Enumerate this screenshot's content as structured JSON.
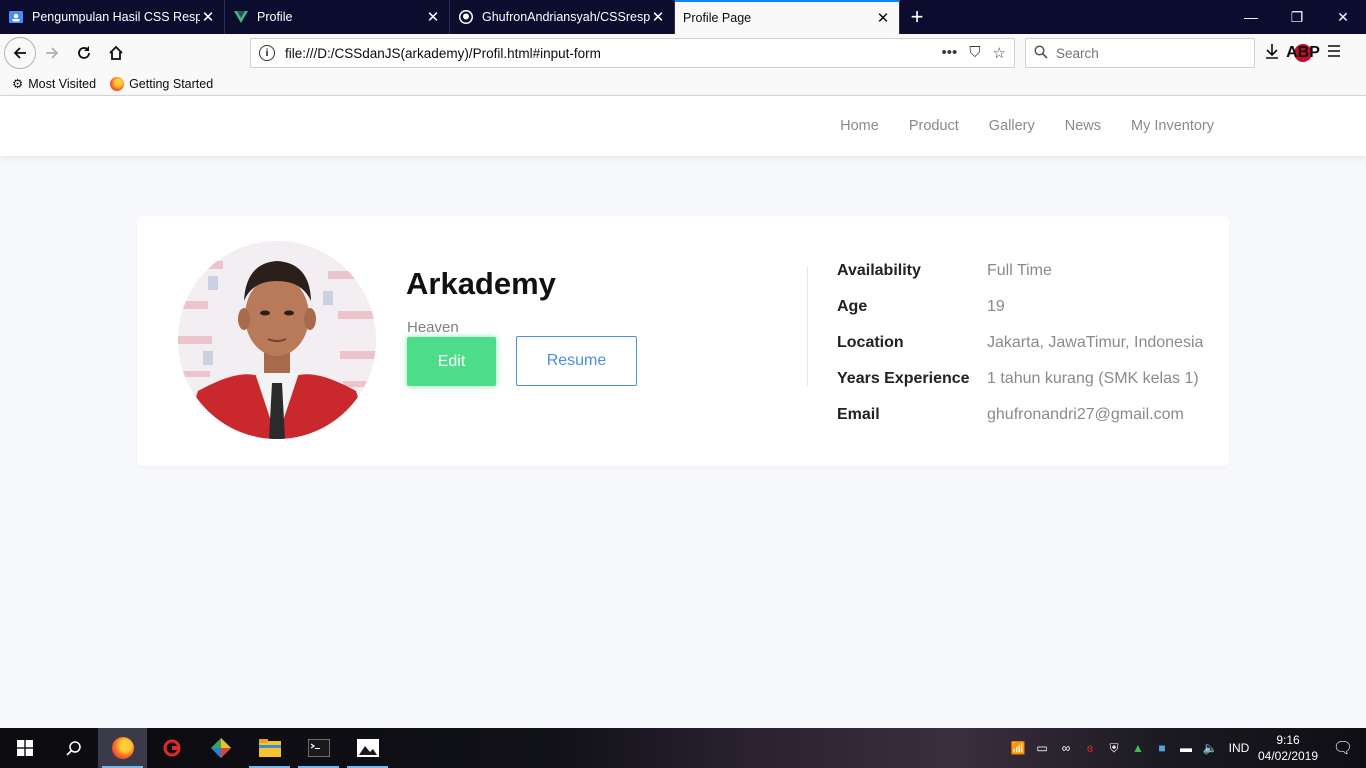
{
  "browser": {
    "tabs": [
      {
        "title": "Pengumpulan Hasil CSS Respo",
        "icon": "classroom-icon",
        "active": false
      },
      {
        "title": "Profile",
        "icon": "vue-icon",
        "active": false
      },
      {
        "title": "GhufronAndriansyah/CSSrespo",
        "icon": "github-icon",
        "active": false
      },
      {
        "title": "Profile Page",
        "icon": "",
        "active": true
      }
    ],
    "new_tab": "+",
    "url": "file:///D:/CSSdanJS(arkademy)/Profil.html#input-form",
    "search_placeholder": "Search",
    "abp_label": "ABP",
    "bookmarks": [
      "Most Visited",
      "Getting Started"
    ]
  },
  "navbar": {
    "links": [
      "Home",
      "Product",
      "Gallery",
      "News",
      "My Inventory"
    ]
  },
  "profile": {
    "name": "Arkademy",
    "role": "Heaven",
    "edit_label": "Edit",
    "resume_label": "Resume",
    "details": [
      {
        "label": "Availability",
        "value": "Full Time"
      },
      {
        "label": "Age",
        "value": "19"
      },
      {
        "label": "Location",
        "value": "Jakarta, JawaTimur, Indonesia"
      },
      {
        "label": "Years Experience",
        "value": "1 tahun kurang (SMK kelas 1)"
      },
      {
        "label": "Email",
        "value": "ghufronandri27@gmail.com"
      }
    ]
  },
  "taskbar": {
    "language": "IND",
    "time": "9:16",
    "date": "04/02/2019"
  },
  "colors": {
    "edit_button": "#4ddc8a",
    "resume_border": "#4a90e2",
    "page_bg": "#f7f8fc",
    "tab_strip": "#0c0c2f"
  }
}
